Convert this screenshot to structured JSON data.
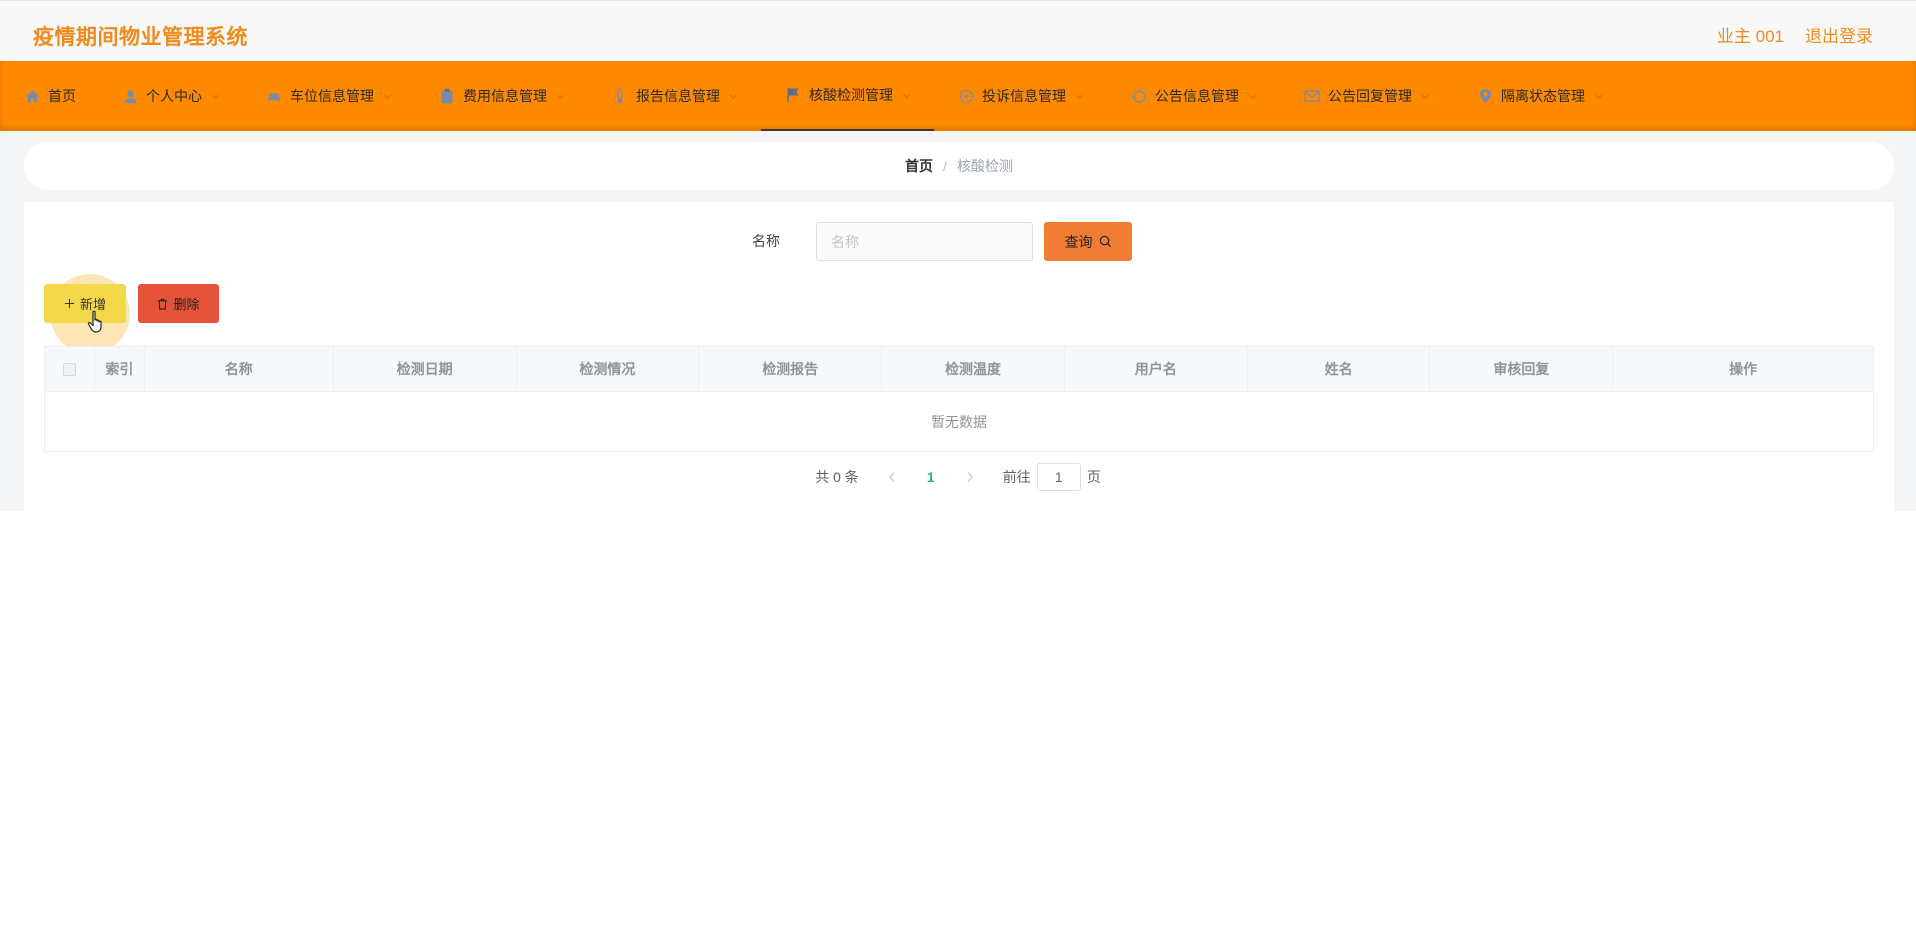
{
  "header": {
    "title": "疫情期间物业管理系统",
    "user": "业主 001",
    "logout": "退出登录"
  },
  "nav": {
    "items": [
      {
        "label": "首页",
        "icon": "home-icon"
      },
      {
        "label": "个人中心",
        "icon": "user-icon"
      },
      {
        "label": "车位信息管理",
        "icon": "car-icon"
      },
      {
        "label": "费用信息管理",
        "icon": "clipboard-icon"
      },
      {
        "label": "报告信息管理",
        "icon": "thermometer-icon"
      },
      {
        "label": "核酸检测管理",
        "icon": "flag-icon"
      },
      {
        "label": "投诉信息管理",
        "icon": "compass-icon"
      },
      {
        "label": "公告信息管理",
        "icon": "aim-icon"
      },
      {
        "label": "公告回复管理",
        "icon": "mail-icon"
      },
      {
        "label": "隔离状态管理",
        "icon": "location-icon"
      }
    ],
    "active": "核酸检测管理"
  },
  "breadcrumb": {
    "home": "首页",
    "separator": "/",
    "current": "核酸检测"
  },
  "search": {
    "label": "名称",
    "placeholder": "名称",
    "value": "",
    "button": "查询"
  },
  "actions": {
    "add": "新增",
    "delete": "删除"
  },
  "table": {
    "columns": [
      "索引",
      "名称",
      "检测日期",
      "检测情况",
      "检测报告",
      "检测温度",
      "用户名",
      "姓名",
      "审核回复",
      "操作"
    ],
    "empty_text": "暂无数据"
  },
  "pagination": {
    "total": "共 0 条",
    "current_page": "1",
    "goto_label": "前往",
    "goto_value": "1",
    "page_suffix": "页"
  },
  "colors": {
    "accent": "#ff8a00",
    "title": "#f08a1c",
    "query_button": "#ef7d34",
    "add_button": "#f5d84a",
    "delete_button": "#e5533a",
    "page_active": "#21b09a"
  }
}
